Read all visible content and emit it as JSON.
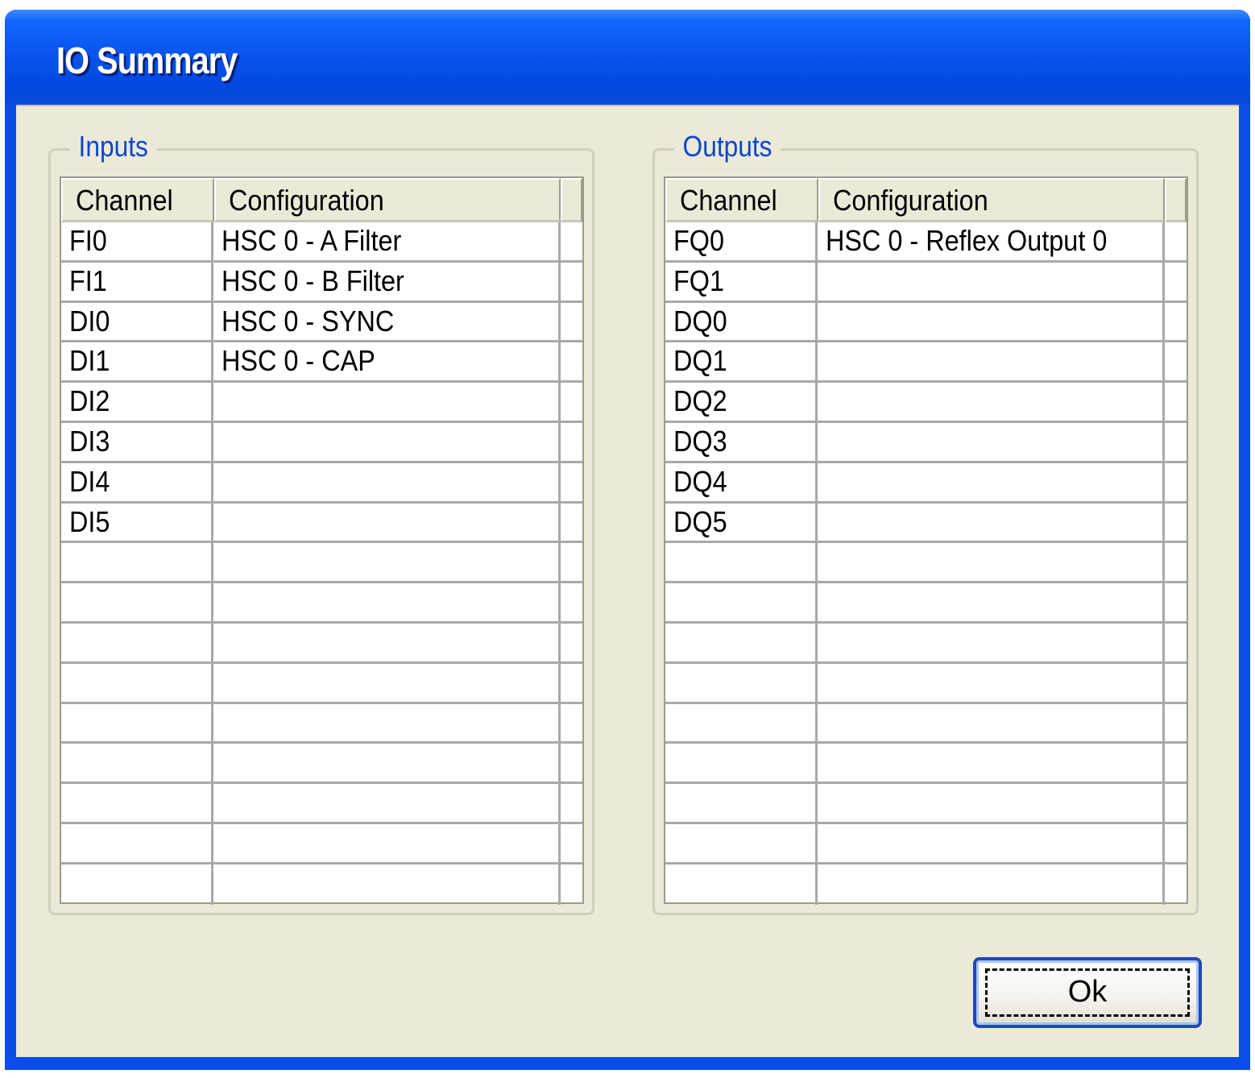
{
  "window": {
    "title": "IO Summary"
  },
  "inputs": {
    "group_label": "Inputs",
    "columns": {
      "channel": "Channel",
      "configuration": "Configuration"
    },
    "rows": [
      {
        "channel": "FI0",
        "configuration": "HSC 0 - A Filter"
      },
      {
        "channel": "FI1",
        "configuration": "HSC 0 - B Filter"
      },
      {
        "channel": "DI0",
        "configuration": "HSC 0 - SYNC"
      },
      {
        "channel": "DI1",
        "configuration": "HSC 0 - CAP"
      },
      {
        "channel": "DI2",
        "configuration": ""
      },
      {
        "channel": "DI3",
        "configuration": ""
      },
      {
        "channel": "DI4",
        "configuration": ""
      },
      {
        "channel": "DI5",
        "configuration": ""
      },
      {
        "channel": "",
        "configuration": ""
      },
      {
        "channel": "",
        "configuration": ""
      },
      {
        "channel": "",
        "configuration": ""
      },
      {
        "channel": "",
        "configuration": ""
      },
      {
        "channel": "",
        "configuration": ""
      },
      {
        "channel": "",
        "configuration": ""
      },
      {
        "channel": "",
        "configuration": ""
      },
      {
        "channel": "",
        "configuration": ""
      },
      {
        "channel": "",
        "configuration": ""
      }
    ]
  },
  "outputs": {
    "group_label": "Outputs",
    "columns": {
      "channel": "Channel",
      "configuration": "Configuration"
    },
    "rows": [
      {
        "channel": "FQ0",
        "configuration": "HSC 0 - Reflex Output 0"
      },
      {
        "channel": "FQ1",
        "configuration": ""
      },
      {
        "channel": "DQ0",
        "configuration": ""
      },
      {
        "channel": "DQ1",
        "configuration": ""
      },
      {
        "channel": "DQ2",
        "configuration": ""
      },
      {
        "channel": "DQ3",
        "configuration": ""
      },
      {
        "channel": "DQ4",
        "configuration": ""
      },
      {
        "channel": "DQ5",
        "configuration": ""
      },
      {
        "channel": "",
        "configuration": ""
      },
      {
        "channel": "",
        "configuration": ""
      },
      {
        "channel": "",
        "configuration": ""
      },
      {
        "channel": "",
        "configuration": ""
      },
      {
        "channel": "",
        "configuration": ""
      },
      {
        "channel": "",
        "configuration": ""
      },
      {
        "channel": "",
        "configuration": ""
      },
      {
        "channel": "",
        "configuration": ""
      },
      {
        "channel": "",
        "configuration": ""
      }
    ]
  },
  "buttons": {
    "ok_label": "Ok"
  },
  "colors": {
    "titlebar": "#0a55ee",
    "client_background": "#ece9d8",
    "group_label": "#0a46d0",
    "button_border": "#1f48b8"
  }
}
